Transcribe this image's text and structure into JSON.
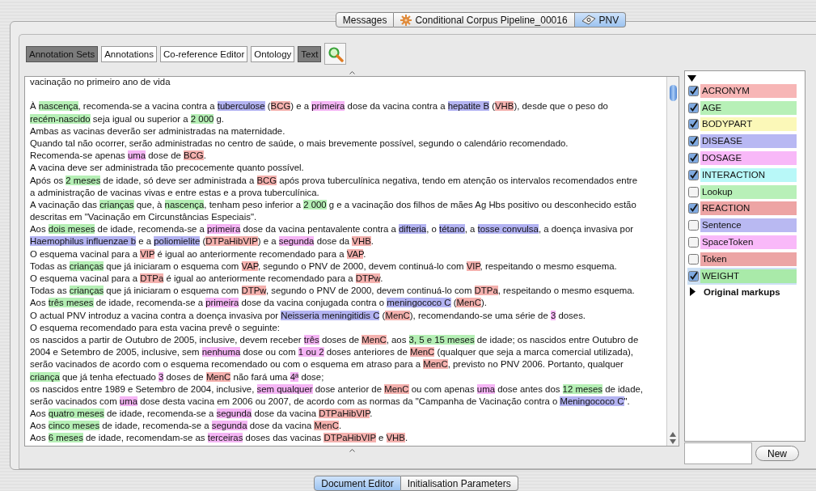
{
  "top_tabs": [
    {
      "label": "Messages",
      "kind": "plain",
      "selected": false
    },
    {
      "label": "Conditional Corpus Pipeline_00016",
      "kind": "pipeline",
      "selected": false
    },
    {
      "label": "PNV",
      "kind": "document",
      "selected": true
    }
  ],
  "toolbar": [
    {
      "label": "Annotation Sets",
      "selected": true
    },
    {
      "label": "Annotations",
      "selected": false
    },
    {
      "label": "Co-reference Editor",
      "selected": false
    },
    {
      "label": "Ontology",
      "selected": false
    },
    {
      "label": "Text",
      "selected": true
    }
  ],
  "document": {
    "lines": [
      {
        "kind": "text",
        "segments": [
          {
            "text": "vacinação no primeiro ano de vida"
          }
        ]
      },
      {
        "kind": "blank"
      },
      {
        "kind": "text",
        "segments": [
          {
            "text": "À "
          },
          {
            "text": "nascença",
            "color": "#b5efb5"
          },
          {
            "text": ", recomenda-se a vacina contra a "
          },
          {
            "text": "tuberculose",
            "color": "#b3b3f2"
          },
          {
            "text": " ("
          },
          {
            "text": "BCG",
            "color": "#f4b1ae"
          },
          {
            "text": ") e a "
          },
          {
            "text": "primeira",
            "color": "#f5b5f5"
          },
          {
            "text": " dose da vacina contra a "
          },
          {
            "text": "hepatite B",
            "color": "#b3b3f2"
          },
          {
            "text": " ("
          },
          {
            "text": "VHB",
            "color": "#f4b1ae"
          },
          {
            "text": "), desde que o peso do"
          }
        ]
      },
      {
        "kind": "text",
        "segments": [
          {
            "text": "recém-nascido",
            "color": "#b5efb5"
          },
          {
            "text": " seja igual ou superior a "
          },
          {
            "text": "2 000",
            "color": "#b5efb5"
          },
          {
            "text": " g."
          }
        ]
      },
      {
        "kind": "text",
        "segments": [
          {
            "text": "Ambas as vacinas deverão ser administradas na maternidade."
          }
        ]
      },
      {
        "kind": "text",
        "segments": [
          {
            "text": "Quando tal não ocorrer, serão administradas no centro de saúde, o mais brevemente possível, segundo o calendário recomendado."
          }
        ]
      },
      {
        "kind": "text",
        "segments": [
          {
            "text": "Recomenda-se apenas "
          },
          {
            "text": "uma",
            "color": "#f5b5f5"
          },
          {
            "text": " dose de "
          },
          {
            "text": "BCG",
            "color": "#f4b1ae"
          },
          {
            "text": "."
          }
        ]
      },
      {
        "kind": "text",
        "segments": [
          {
            "text": "A vacina deve ser administrada tão precocemente quanto possível."
          }
        ]
      },
      {
        "kind": "text",
        "segments": [
          {
            "text": "Após os "
          },
          {
            "text": "2 meses",
            "color": "#b5efb5"
          },
          {
            "text": " de idade, só deve ser administrada a  "
          },
          {
            "text": "BCG",
            "color": "#f4b1ae"
          },
          {
            "text": " após prova tuberculínica negativa, tendo em atenção os intervalos recomendados entre"
          }
        ]
      },
      {
        "kind": "text",
        "segments": [
          {
            "text": "a administração de vacinas vivas e entre estas e a prova tuberculínica."
          }
        ]
      },
      {
        "kind": "text",
        "segments": [
          {
            "text": "A vacinação das "
          },
          {
            "text": "crianças",
            "color": "#b5efb5"
          },
          {
            "text": " que, à "
          },
          {
            "text": "nascença",
            "color": "#b5efb5"
          },
          {
            "text": ", tenham peso inferior a "
          },
          {
            "text": "2 000",
            "color": "#b5efb5"
          },
          {
            "text": " g e a vacinação dos filhos de mães Ag Hbs positivo ou desconhecido estão"
          }
        ]
      },
      {
        "kind": "text",
        "segments": [
          {
            "text": "descritas em \"Vacinação em Circunstâncias Especiais\"."
          }
        ]
      },
      {
        "kind": "text",
        "segments": [
          {
            "text": "Aos "
          },
          {
            "text": "dois meses",
            "color": "#b5efb5"
          },
          {
            "text": " de idade, recomenda-se a "
          },
          {
            "text": "primeira",
            "color": "#f5b5f5"
          },
          {
            "text": " dose da vacina pentavalente contra a "
          },
          {
            "text": "difteria",
            "color": "#b3b3f2"
          },
          {
            "text": ", o "
          },
          {
            "text": "tétano",
            "color": "#b3b3f2"
          },
          {
            "text": ", a "
          },
          {
            "text": "tosse convulsa",
            "color": "#b3b3f2"
          },
          {
            "text": ", a doença invasiva por"
          }
        ]
      },
      {
        "kind": "text",
        "segments": [
          {
            "text": "Haemophilus influenzae b",
            "color": "#b3b3f2"
          },
          {
            "text": " e a "
          },
          {
            "text": "poliomielite",
            "color": "#b3b3f2"
          },
          {
            "text": " ("
          },
          {
            "text": "DTPaHibVIP",
            "color": "#f4b1ae"
          },
          {
            "text": ") e a "
          },
          {
            "text": "segunda",
            "color": "#f5b5f5"
          },
          {
            "text": " dose da "
          },
          {
            "text": "VHB",
            "color": "#f4b1ae"
          },
          {
            "text": "."
          }
        ]
      },
      {
        "kind": "text",
        "segments": [
          {
            "text": "O esquema vacinal para a "
          },
          {
            "text": "VIP",
            "color": "#f4b1ae"
          },
          {
            "text": " é igual ao anteriormente recomendado para a "
          },
          {
            "text": "VAP",
            "color": "#f4b1ae"
          },
          {
            "text": "."
          }
        ]
      },
      {
        "kind": "text",
        "segments": [
          {
            "text": "Todas as "
          },
          {
            "text": "crianças",
            "color": "#b5efb5"
          },
          {
            "text": " que já iniciaram o esquema com "
          },
          {
            "text": "VAP",
            "color": "#f4b1ae"
          },
          {
            "text": ", segundo o PNV de 2000, devem continuá-lo com "
          },
          {
            "text": "VIP",
            "color": "#f4b1ae"
          },
          {
            "text": ", respeitando o mesmo esquema."
          }
        ]
      },
      {
        "kind": "text",
        "segments": [
          {
            "text": "O esquema vacinal para a "
          },
          {
            "text": "DTPa",
            "color": "#f4b1ae"
          },
          {
            "text": " é igual ao anteriormente recomendado para a "
          },
          {
            "text": "DTPw",
            "color": "#f4b1ae"
          },
          {
            "text": "."
          }
        ]
      },
      {
        "kind": "text",
        "segments": [
          {
            "text": "Todas as "
          },
          {
            "text": "crianças",
            "color": "#b5efb5"
          },
          {
            "text": " que já iniciaram o esquema com "
          },
          {
            "text": "DTPw",
            "color": "#f4b1ae"
          },
          {
            "text": ", segundo o PNV de 2000, devem continuá-lo com "
          },
          {
            "text": "DTPa",
            "color": "#f4b1ae"
          },
          {
            "text": ", respeitando o mesmo esquema."
          }
        ]
      },
      {
        "kind": "text",
        "segments": [
          {
            "text": "Aos "
          },
          {
            "text": "três meses",
            "color": "#b5efb5"
          },
          {
            "text": " de idade, recomenda-se a "
          },
          {
            "text": "primeira",
            "color": "#f5b5f5"
          },
          {
            "text": " dose da vacina conjugada contra o "
          },
          {
            "text": "meningococo C",
            "color": "#b3b3f2"
          },
          {
            "text": " ("
          },
          {
            "text": "MenC",
            "color": "#f4b1ae"
          },
          {
            "text": ")."
          }
        ]
      },
      {
        "kind": "text",
        "segments": [
          {
            "text": "O actual PNV introduz a vacina contra a doença invasiva por "
          },
          {
            "text": "Neisseria meningitidis C",
            "color": "#b3b3f2"
          },
          {
            "text": " ("
          },
          {
            "text": "MenC",
            "color": "#f4b1ae"
          },
          {
            "text": "), recomendando-se uma série de "
          },
          {
            "text": "3",
            "color": "#f5b5f5"
          },
          {
            "text": " doses."
          }
        ]
      },
      {
        "kind": "text",
        "segments": [
          {
            "text": "O esquema recomendado para esta vacina prevê o seguinte:"
          }
        ]
      },
      {
        "kind": "text",
        "segments": [
          {
            "text": "os nascidos a partir de Outubro de 2005, inclusive, devem receber "
          },
          {
            "text": "três",
            "color": "#f5b5f5"
          },
          {
            "text": " doses de "
          },
          {
            "text": "MenC",
            "color": "#f4b1ae"
          },
          {
            "text": ", aos "
          },
          {
            "text": "3, 5 e 15 meses",
            "color": "#b5efb5"
          },
          {
            "text": " de idade; os nascidos entre Outubro de"
          }
        ]
      },
      {
        "kind": "text",
        "segments": [
          {
            "text": "2004 e Setembro de 2005, inclusive, sem "
          },
          {
            "text": "nenhuma",
            "color": "#f5b5f5"
          },
          {
            "text": " dose ou com "
          },
          {
            "text": "1 ou 2",
            "color": "#f5b5f5"
          },
          {
            "text": " doses anteriores  de "
          },
          {
            "text": "MenC",
            "color": "#f4b1ae"
          },
          {
            "text": " (qualquer que seja a marca comercial utilizada),"
          }
        ]
      },
      {
        "kind": "text",
        "segments": [
          {
            "text": "serão vacinados de acordo com o esquema recomendado ou com o esquema em atraso para a "
          },
          {
            "text": "MenC",
            "color": "#f4b1ae"
          },
          {
            "text": ", previsto no PNV 2006. Portanto, qualquer"
          }
        ]
      },
      {
        "kind": "text",
        "segments": [
          {
            "text": "criança",
            "color": "#b5efb5"
          },
          {
            "text": " que já tenha efectuado "
          },
          {
            "text": "3",
            "color": "#f5b5f5"
          },
          {
            "text": " doses de "
          },
          {
            "text": "MenC",
            "color": "#f4b1ae"
          },
          {
            "text": " não fará uma "
          },
          {
            "text": "4ª",
            "color": "#f5b5f5"
          },
          {
            "text": " dose;"
          }
        ]
      },
      {
        "kind": "text",
        "segments": [
          {
            "text": "os nascidos entre 1989 e Setembro de 2004, inclusive, "
          },
          {
            "text": "sem qualquer",
            "color": "#f5b5f5"
          },
          {
            "text": " dose anterior de "
          },
          {
            "text": "MenC",
            "color": "#f4b1ae"
          },
          {
            "text": " ou com apenas "
          },
          {
            "text": "uma",
            "color": "#f5b5f5"
          },
          {
            "text": " dose antes dos "
          },
          {
            "text": "12 meses",
            "color": "#b5efb5"
          },
          {
            "text": " de idade,"
          }
        ]
      },
      {
        "kind": "text",
        "segments": [
          {
            "text": "serão vacinados com "
          },
          {
            "text": "uma",
            "color": "#f5b5f5"
          },
          {
            "text": " dose desta vacina em 2006 ou 2007, de acordo com as normas da \"Campanha de Vacinação contra o "
          },
          {
            "text": "Meningococo C",
            "color": "#b3b3f2"
          },
          {
            "text": "\"."
          }
        ]
      },
      {
        "kind": "text",
        "segments": [
          {
            "text": "Aos "
          },
          {
            "text": "quatro meses",
            "color": "#b5efb5"
          },
          {
            "text": " de idade, recomenda-se a "
          },
          {
            "text": "segunda",
            "color": "#f5b5f5"
          },
          {
            "text": " dose da vacina "
          },
          {
            "text": "DTPaHibVIP",
            "color": "#f4b1ae"
          },
          {
            "text": "."
          }
        ]
      },
      {
        "kind": "text",
        "segments": [
          {
            "text": "Aos "
          },
          {
            "text": "cinco meses",
            "color": "#b5efb5"
          },
          {
            "text": " de idade, recomenda-se a "
          },
          {
            "text": "segunda",
            "color": "#f5b5f5"
          },
          {
            "text": " dose da vacina "
          },
          {
            "text": "MenC",
            "color": "#f4b1ae"
          },
          {
            "text": "."
          }
        ]
      },
      {
        "kind": "text",
        "segments": [
          {
            "text": "Aos "
          },
          {
            "text": "6 meses",
            "color": "#b5efb5"
          },
          {
            "text": " de idade, recomendam-se as "
          },
          {
            "text": "terceiras",
            "color": "#f5b5f5"
          },
          {
            "text": " doses das vacinas "
          },
          {
            "text": "DTPaHibVIP",
            "color": "#f4b1ae"
          },
          {
            "text": " e "
          },
          {
            "text": "VHB",
            "color": "#f4b1ae"
          },
          {
            "text": "."
          }
        ]
      }
    ]
  },
  "annotation_sets": [
    {
      "expanded": true,
      "types": [
        {
          "label": "ACRONYM",
          "checked": true,
          "selected": false,
          "color": "#f7b6b6"
        },
        {
          "label": "AGE",
          "checked": true,
          "selected": false,
          "color": "#b7f0b7"
        },
        {
          "label": "BODYPART",
          "checked": true,
          "selected": false,
          "color": "#fbf8b8"
        },
        {
          "label": "DISEASE",
          "checked": true,
          "selected": false,
          "color": "#b8b8f3"
        },
        {
          "label": "DOSAGE",
          "checked": true,
          "selected": false,
          "color": "#f8b8f8"
        },
        {
          "label": "INTERACTION",
          "checked": true,
          "selected": false,
          "color": "#b8f8f8"
        },
        {
          "label": "Lookup",
          "checked": false,
          "selected": false,
          "color": "#b8f0b8"
        },
        {
          "label": "REACTION",
          "checked": true,
          "selected": false,
          "color": "#eda4a4"
        },
        {
          "label": "Sentence",
          "checked": false,
          "selected": false,
          "color": "#b9b9f2"
        },
        {
          "label": "SpaceToken",
          "checked": false,
          "selected": false,
          "color": "#f9b9f9"
        },
        {
          "label": "Token",
          "checked": false,
          "selected": false,
          "color": "#eca5a5"
        },
        {
          "label": "WEIGHT",
          "checked": true,
          "selected": true,
          "color": "#a9eaa9"
        }
      ]
    },
    {
      "label": "Original markups",
      "expanded": false
    }
  ],
  "new_button": "New",
  "bottom_tabs": [
    {
      "label": "Document Editor",
      "selected": true
    },
    {
      "label": "Initialisation Parameters",
      "selected": false
    }
  ]
}
